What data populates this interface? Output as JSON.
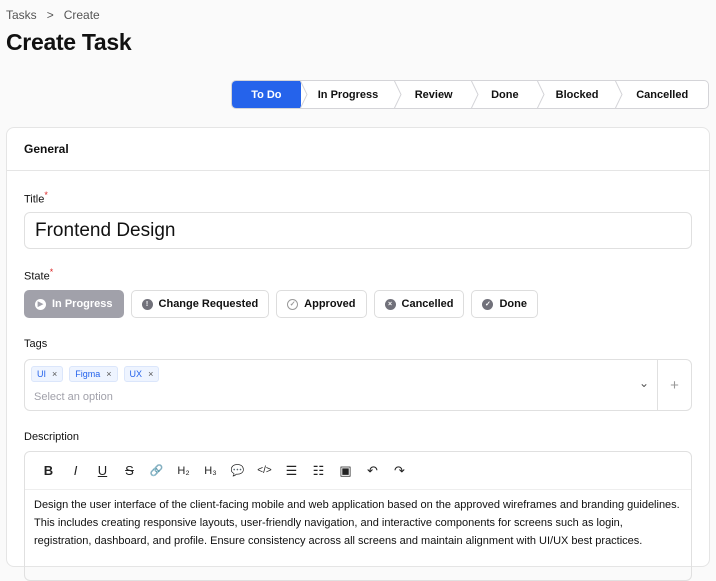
{
  "breadcrumb": {
    "items": [
      "Tasks",
      "Create"
    ],
    "separator": ">"
  },
  "page_title": "Create Task",
  "steps": [
    {
      "label": "To Do",
      "active": true
    },
    {
      "label": "In Progress"
    },
    {
      "label": "Review"
    },
    {
      "label": "Done"
    },
    {
      "label": "Blocked"
    },
    {
      "label": "Cancelled"
    }
  ],
  "section": {
    "title": "General"
  },
  "title_field": {
    "label": "Title",
    "required": "*",
    "value": "Frontend Design"
  },
  "state_field": {
    "label": "State",
    "required": "*",
    "options": [
      {
        "label": "In Progress",
        "icon": "▶"
      },
      {
        "label": "Change Requested",
        "icon": "!"
      },
      {
        "label": "Approved",
        "icon": "✓"
      },
      {
        "label": "Cancelled",
        "icon": "×"
      },
      {
        "label": "Done",
        "icon": "✓"
      }
    ]
  },
  "tags_field": {
    "label": "Tags",
    "tags": [
      "UI",
      "Figma",
      "UX"
    ],
    "placeholder": "Select an option",
    "remove": "×",
    "add": "+"
  },
  "description": {
    "label": "Description",
    "toolbar": {
      "bold": "B",
      "italic": "I",
      "underline": "U",
      "strike": "S",
      "link": "🔗",
      "h2": "H₂",
      "h3": "H₃",
      "blockquote": "💬",
      "code": "</>",
      "bullet": "☰",
      "ordered": "☷",
      "image": "▣",
      "undo": "↶",
      "redo": "↷"
    },
    "text": "Design the user interface of the client-facing mobile and web application based on the approved wireframes and branding guidelines. This includes creating responsive layouts, user-friendly navigation, and interactive components for screens such as login, registration, dashboard, and profile. Ensure consistency across all screens and maintain alignment with UI/UX best practices."
  },
  "colors": {
    "accent": "#2563eb",
    "required": "#dc2626"
  }
}
